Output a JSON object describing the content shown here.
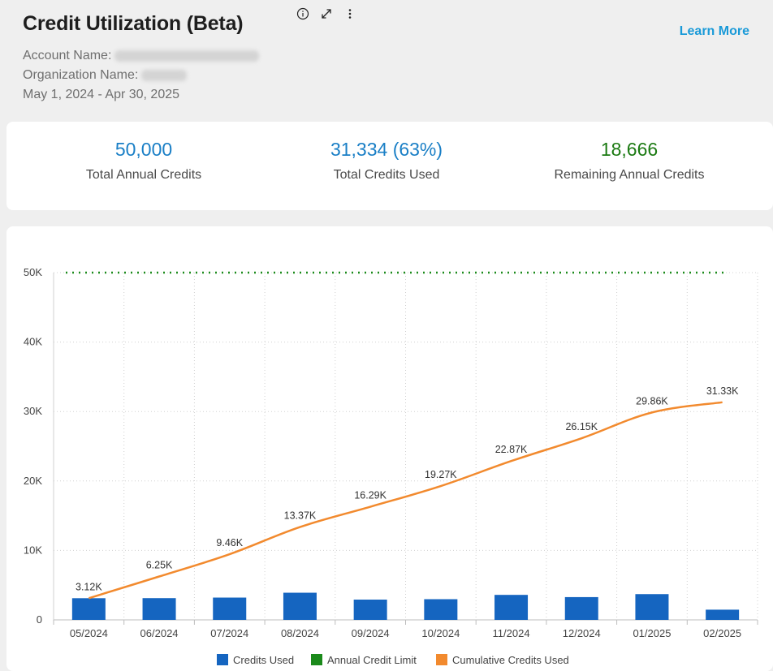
{
  "header": {
    "title": "Credit Utilization (Beta)",
    "learn_more": "Learn More",
    "account_label": "Account Name:",
    "organization_label": "Organization Name:",
    "date_range": "May 1, 2024 - Apr 30, 2025",
    "icons": [
      "info-icon",
      "expand-icon",
      "more-vertical-icon"
    ]
  },
  "kpis": {
    "total": {
      "value": "50,000",
      "label": "Total Annual Credits",
      "color": "#1a7fc6"
    },
    "used": {
      "value": "31,334 (63%)",
      "label": "Total Credits Used",
      "color": "#1a7fc6"
    },
    "remaining": {
      "value": "18,666",
      "label": "Remaining Annual Credits",
      "color": "#1b7a12"
    }
  },
  "chart_data": {
    "type": "bar",
    "categories": [
      "05/2024",
      "06/2024",
      "07/2024",
      "08/2024",
      "09/2024",
      "10/2024",
      "11/2024",
      "12/2024",
      "01/2025",
      "02/2025"
    ],
    "series": [
      {
        "name": "Credits Used",
        "type": "bar",
        "color": "#1565c0",
        "values": [
          3120,
          3130,
          3210,
          3910,
          2920,
          2980,
          3600,
          3280,
          3710,
          1470
        ]
      },
      {
        "name": "Annual Credit Limit",
        "type": "line",
        "style": "dotted",
        "color": "#1b8a1b",
        "values": [
          50000,
          50000,
          50000,
          50000,
          50000,
          50000,
          50000,
          50000,
          50000,
          50000
        ]
      },
      {
        "name": "Cumulative Credits Used",
        "type": "line",
        "color": "#f28a2e",
        "values": [
          3120,
          6250,
          9460,
          13370,
          16290,
          19270,
          22870,
          26150,
          29860,
          31330
        ],
        "data_labels": [
          "3.12K",
          "6.25K",
          "9.46K",
          "13.37K",
          "16.29K",
          "19.27K",
          "22.87K",
          "26.15K",
          "29.86K",
          "31.33K"
        ]
      }
    ],
    "ylim": [
      0,
      50000
    ],
    "yticks": [
      0,
      10000,
      20000,
      30000,
      40000,
      50000
    ],
    "ytick_labels": [
      "0",
      "10K",
      "20K",
      "30K",
      "40K",
      "50K"
    ],
    "grid": true,
    "legend": "bottom-center"
  }
}
